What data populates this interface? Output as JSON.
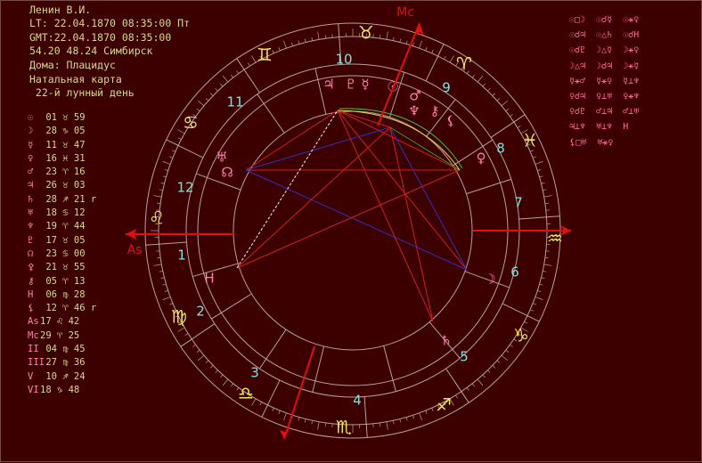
{
  "header": {
    "name": "Ленин В.И.",
    "lt": "LT: 22.04.1870 08:35:00 Пт",
    "gmt": "GMT:22.04.1870 08:35:00",
    "coords": "54.20 48.24 Симбирск",
    "houses": "Дома: Плацидус",
    "chart_type": "Натальная карта",
    "lunar_day": " 22-й лунный день"
  },
  "planets": [
    {
      "glyph": "☉",
      "text": " 01 ♉ 59",
      "color": "#ff80b0"
    },
    {
      "glyph": "☽",
      "text": " 28 ♑ 05",
      "color": "#ff80b0"
    },
    {
      "glyph": "☿",
      "text": " 11 ♉ 47",
      "color": "#ff80b0"
    },
    {
      "glyph": "♀",
      "text": " 16 ♓ 31",
      "color": "#ff80b0"
    },
    {
      "glyph": "♂",
      "text": " 23 ♈ 16",
      "color": "#ff80b0"
    },
    {
      "glyph": "♃",
      "text": " 26 ♉ 03",
      "color": "#ff80b0"
    },
    {
      "glyph": "♄",
      "text": " 28 ♐ 21 r",
      "color": "#ff80b0"
    },
    {
      "glyph": "♅",
      "text": " 18 ♋ 12",
      "color": "#ff80b0"
    },
    {
      "glyph": "♆",
      "text": " 19 ♈ 44",
      "color": "#ff80b0"
    },
    {
      "glyph": "♇",
      "text": " 17 ♉ 05",
      "color": "#ff80b0"
    },
    {
      "glyph": "☊",
      "text": " 23 ♋ 00",
      "color": "#ff80b0"
    },
    {
      "glyph": "⚴",
      "text": " 21 ♉ 55",
      "color": "#ff80b0"
    },
    {
      "glyph": "⚷",
      "text": " 05 ♈ 13",
      "color": "#ff80b0"
    },
    {
      "glyph": "H",
      "text": " 06 ♍ 28",
      "color": "#ff80b0"
    },
    {
      "glyph": "⚸",
      "text": " 12 ♈ 46 r",
      "color": "#ff80b0"
    },
    {
      "glyph": "As",
      "text": "17 ♌ 42",
      "color": "#ff80b0"
    },
    {
      "glyph": "Mc",
      "text": "29 ♈ 25",
      "color": "#ff80b0"
    },
    {
      "glyph": "II",
      "text": " 04 ♍ 45",
      "color": "#ff80b0"
    },
    {
      "glyph": "III",
      "text": " 27 ♍ 36",
      "color": "#ff80b0"
    },
    {
      "glyph": "V",
      "text": " 10 ♐ 24",
      "color": "#ff80b0"
    },
    {
      "glyph": "VI",
      "text": "18 ♑ 48",
      "color": "#ff80b0"
    }
  ],
  "aspects": [
    "☉□☽  ☉☌☿  ☉⚹♀",
    "☉☌♃  ☉△♄  ☉☌H",
    "☉☌♇  ☽△☿  ☽⚹♀",
    "☽△♃  ☽☌♃  ☽⚹☿",
    "☿⚹♂  ☿⚹♀  ☿⊥♆",
    "♀☌♃  ♀⊥♅  ♀⚹♆",
    "♀☌♇  ♂⊥♃  ♂⊥♅",
    "♃⊥♆  ♅⊥♆  H",
    "⚸□♅  ♅⚹♀"
  ],
  "wheel": {
    "mc_label": "Mc",
    "as_label": "As",
    "house_numbers": [
      "1",
      "2",
      "3",
      "4",
      "5",
      "6",
      "7",
      "8",
      "9",
      "10",
      "11",
      "12"
    ],
    "signs": [
      "♈",
      "♉",
      "♊",
      "♋",
      "♌",
      "♍",
      "♎",
      "♏",
      "♐",
      "♑",
      "♒",
      "♓"
    ],
    "colors": {
      "sign": "#e8e860",
      "house": "#80e0e0",
      "planet": "#ff80b0",
      "mc_as": "#e01010",
      "ring": "#b8a0a0"
    }
  }
}
